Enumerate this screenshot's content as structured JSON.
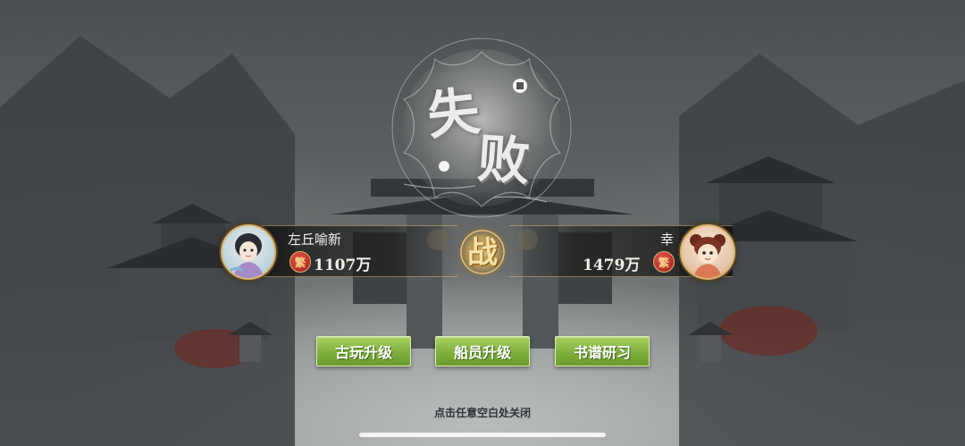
{
  "result": {
    "title_char_1": "失",
    "title_char_2": "败"
  },
  "vs": {
    "label": "战"
  },
  "player_left": {
    "name": "左丘喻新",
    "power": "1107万",
    "power_icon_glyph": "繁"
  },
  "player_right": {
    "name": "幸",
    "power": "1479万",
    "power_icon_glyph": "繁"
  },
  "actions": {
    "antique_upgrade": "古玩升级",
    "crew_upgrade": "船员升级",
    "book_study": "书谱研习"
  },
  "hint": {
    "close_text": "点击任意空白处关闭"
  },
  "colors": {
    "button_green": "#82b23f",
    "gold_accent": "#d9b56e",
    "power_icon_red": "#9f1e18"
  }
}
